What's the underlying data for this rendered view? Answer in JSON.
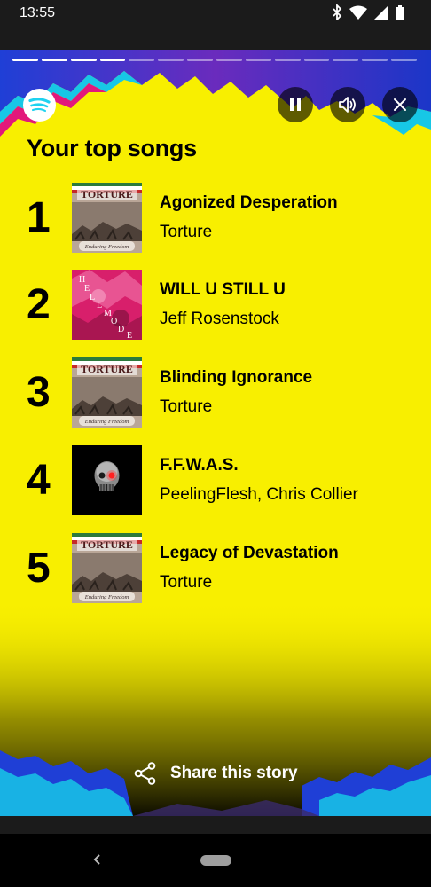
{
  "status_bar": {
    "time": "13:55"
  },
  "story": {
    "title": "Your top songs",
    "progress_segments_total": 14,
    "progress_segments_done": 4,
    "controls": [
      "pause-icon",
      "volume-icon",
      "close-icon"
    ],
    "share_label": "Share this story",
    "colors": {
      "background": "#f8ef00",
      "accent_blue": "#1f3fd6",
      "accent_cyan": "#17c7e6",
      "accent_pink": "#e2187b"
    },
    "songs": [
      {
        "rank": "1",
        "title": "Agonized Desperation",
        "artist": "Torture"
      },
      {
        "rank": "2",
        "title": "WILL U STILL U",
        "artist": "Jeff Rosenstock"
      },
      {
        "rank": "3",
        "title": "Blinding Ignorance",
        "artist": "Torture"
      },
      {
        "rank": "4",
        "title": "F.F.W.A.S.",
        "artist": "PeelingFlesh, Chris Collier"
      },
      {
        "rank": "5",
        "title": "Legacy of Devastation",
        "artist": "Torture"
      }
    ]
  },
  "album_art_text": {
    "torture_band": "TORTURE",
    "torture_album": "Enduring Freedom",
    "hellmode_letters": [
      "H",
      "E",
      "L",
      "L",
      "M",
      "O",
      "D",
      "E"
    ]
  },
  "nav_bar": {
    "buttons": [
      "back-icon",
      "home-pill"
    ]
  }
}
